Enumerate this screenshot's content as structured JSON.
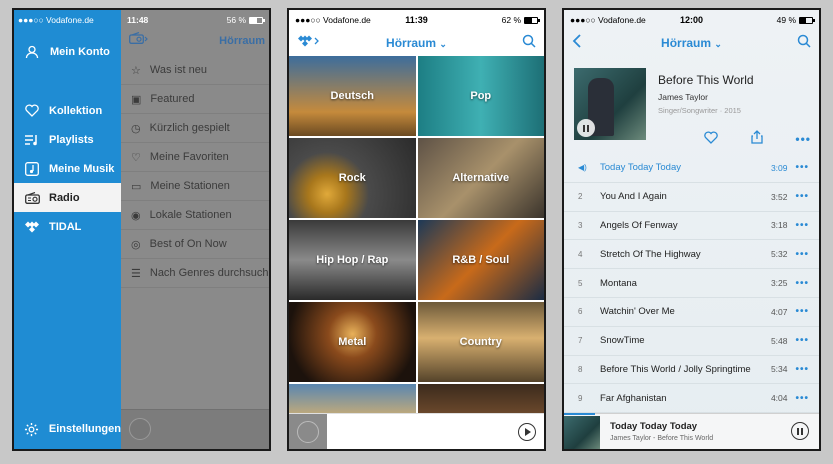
{
  "colors": {
    "accent": "#2a8ad4",
    "sidebar": "#1f8cd3"
  },
  "phone1": {
    "status": {
      "carrier": "●●●○○ Vodafone.de",
      "time": "11:48",
      "battery": "56 %",
      "battery_level": 0.56
    },
    "menu": {
      "account": "Mein Konto",
      "items": [
        {
          "label": "Kollektion",
          "icon": "heart-icon"
        },
        {
          "label": "Playlists",
          "icon": "playlist-icon"
        },
        {
          "label": "Meine Musik",
          "icon": "music-note-icon"
        },
        {
          "label": "Radio",
          "icon": "radio-icon",
          "active": true
        },
        {
          "label": "TIDAL",
          "icon": "tidal-icon"
        }
      ],
      "settings": "Einstellungen"
    },
    "content": {
      "title": "Hörraum",
      "items": [
        "Was ist neu",
        "Featured",
        "Kürzlich gespielt",
        "Meine Favoriten",
        "Meine Stationen",
        "Lokale Stationen",
        "Best of On Now",
        "Nach Genres durchsuchen"
      ]
    }
  },
  "phone2": {
    "status": {
      "carrier": "●●●○○ Vodafone.de",
      "time": "11:39",
      "battery": "62 %",
      "battery_level": 0.62
    },
    "title": "Hörraum",
    "genres": [
      "Deutsch",
      "Pop",
      "Rock",
      "Alternative",
      "Hip Hop / Rap",
      "R&B / Soul",
      "Metal",
      "Country"
    ]
  },
  "phone3": {
    "status": {
      "carrier": "●●●○○ Vodafone.de",
      "time": "12:00",
      "battery": "49 %",
      "battery_level": 0.49
    },
    "title": "Hörraum",
    "album": {
      "title": "Before This World",
      "artist": "James Taylor",
      "meta": "Singer/Songwriter · 2015"
    },
    "tracks": [
      {
        "num": "",
        "title": "Today Today Today",
        "duration": "3:09",
        "current": true
      },
      {
        "num": "2",
        "title": "You And I Again",
        "duration": "3:52"
      },
      {
        "num": "3",
        "title": "Angels Of Fenway",
        "duration": "3:18"
      },
      {
        "num": "4",
        "title": "Stretch Of The Highway",
        "duration": "5:32"
      },
      {
        "num": "5",
        "title": "Montana",
        "duration": "3:25"
      },
      {
        "num": "6",
        "title": "Watchin' Over Me",
        "duration": "4:07"
      },
      {
        "num": "7",
        "title": "SnowTime",
        "duration": "5:48"
      },
      {
        "num": "8",
        "title": "Before This World / Jolly Springtime",
        "duration": "5:34"
      },
      {
        "num": "9",
        "title": "Far Afghanistan",
        "duration": "4:04"
      }
    ],
    "now_playing": {
      "title": "Today Today Today",
      "subtitle": "James Taylor - Before This World",
      "progress": 0.12
    }
  }
}
